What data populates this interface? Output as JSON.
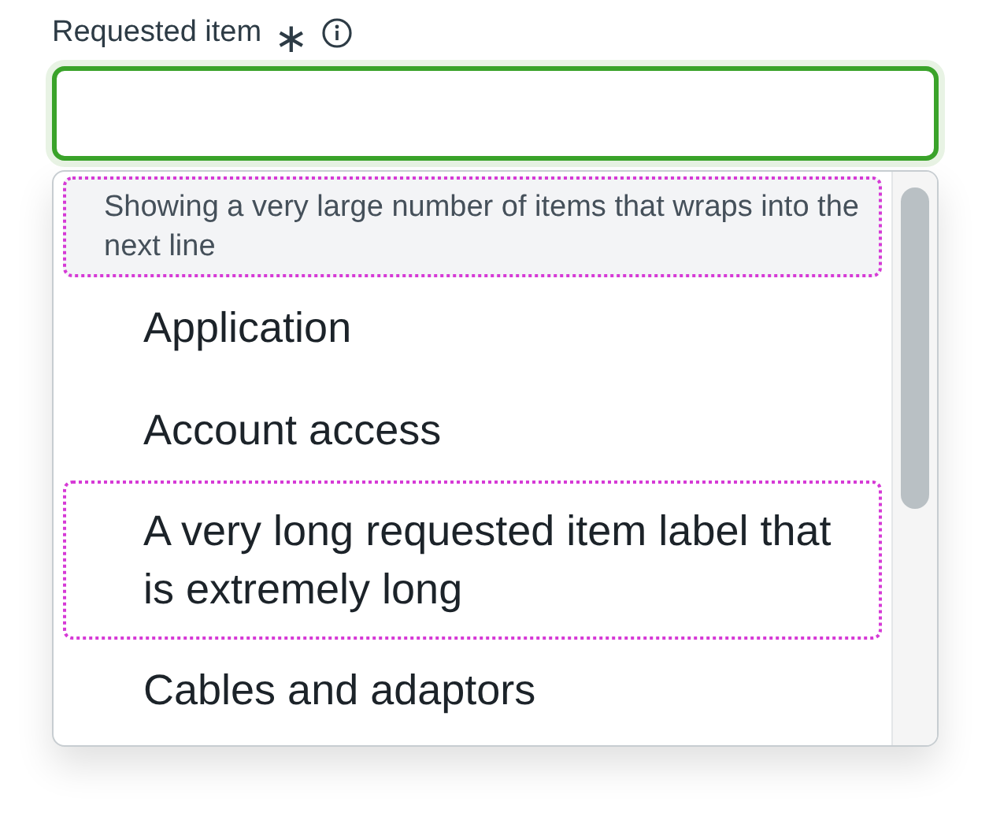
{
  "field": {
    "label": "Requested item",
    "required_mark": "∗",
    "focused": true
  },
  "listbox": {
    "header": {
      "text": "Showing a very large number of items that wraps into the next line",
      "focused": true
    },
    "options": [
      {
        "label": "Application",
        "focused": false
      },
      {
        "label": "Account access",
        "focused": false
      },
      {
        "label": "A very long requested item label that is extremely long",
        "focused": true
      },
      {
        "label": "Cables and adaptors",
        "focused": false
      }
    ]
  }
}
